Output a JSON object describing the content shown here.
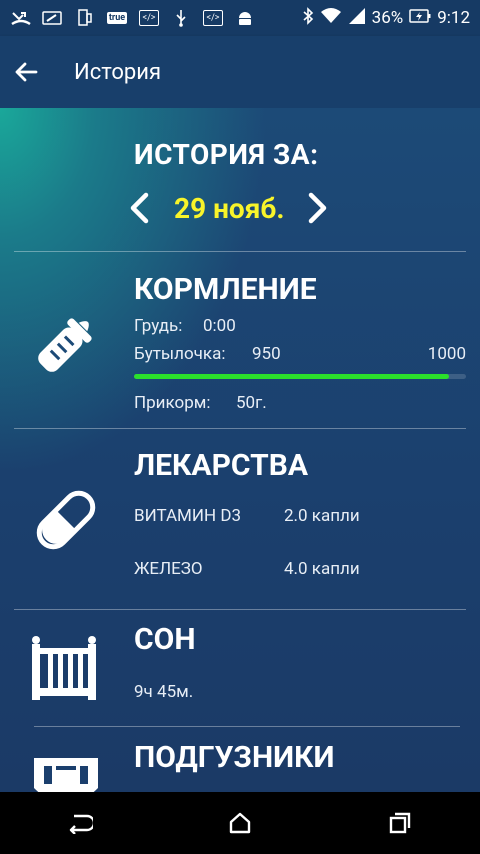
{
  "status_bar": {
    "battery_percent": "36%",
    "time": "9:12",
    "true_badge": "true",
    "left_icons": [
      "missed-call-icon",
      "battery-saver-icon",
      "phone-icon",
      "true-app-icon",
      "code-icon",
      "usb-icon",
      "code-icon",
      "android-icon"
    ],
    "right_icons": [
      "bluetooth-icon",
      "wifi-icon",
      "signal-icon",
      "battery-icon"
    ]
  },
  "appbar": {
    "title": "История"
  },
  "history": {
    "heading": "ИСТОРИЯ ЗА:",
    "date": "29 нояб."
  },
  "feeding": {
    "title": "КОРМЛЕНИЕ",
    "breast_label": "Грудь:",
    "breast_value": "0:00",
    "bottle_label": "Бутылочка:",
    "bottle_value": "950",
    "bottle_goal": "1000",
    "bottle_progress_fraction": 0.95,
    "solids_label": "Прикорм:",
    "solids_value": "50г."
  },
  "medicine": {
    "title": "ЛЕКАРСТВА",
    "items": [
      {
        "name": "ВИТАМИН D3",
        "dose": "2.0 капли"
      },
      {
        "name": "ЖЕЛЕЗО",
        "dose": "4.0 капли"
      }
    ]
  },
  "sleep": {
    "title": "СОН",
    "value": "9ч 45м."
  },
  "diapers": {
    "title": "ПОДГУЗНИКИ"
  },
  "colors": {
    "accent_date": "#f8f42a",
    "progress": "#2be02b",
    "background": "#1d3d6a"
  }
}
